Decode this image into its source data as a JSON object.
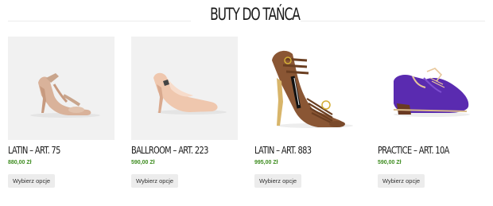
{
  "section": {
    "title": "BUTY DO TAŃCA"
  },
  "products": [
    {
      "name": "LATIN – ART. 75",
      "price": "880,00 Zł",
      "button": "Wybierz opcje"
    },
    {
      "name": "BALLROOM – ART. 223",
      "price": "590,00 Zł",
      "button": "Wybierz opcje"
    },
    {
      "name": "LATIN – ART. 883",
      "price": "995,00 Zł",
      "button": "Wybierz opcje"
    },
    {
      "name": "PRACTICE – ART. 10A",
      "price": "590,00 Zł",
      "button": "Wybierz opcje"
    }
  ],
  "colors": {
    "price": "#3d8c1f",
    "button_bg": "#ececec",
    "image_bg": "#f1f1f1"
  }
}
